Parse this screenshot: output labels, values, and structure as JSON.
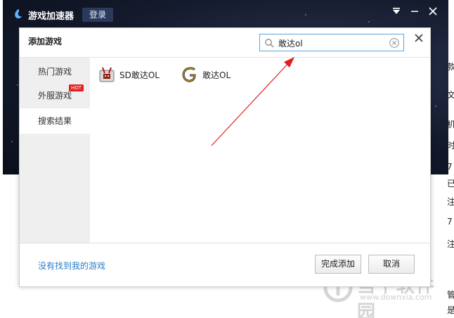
{
  "app": {
    "title": "游戏加速器",
    "login_label": "登录"
  },
  "dialog": {
    "title": "添加游戏",
    "search": {
      "value": "敢达ol",
      "placeholder": ""
    },
    "sidebar": {
      "items": [
        {
          "label": "热门游戏"
        },
        {
          "label": "外服游戏",
          "badge": "HOT"
        },
        {
          "label": "搜索结果"
        }
      ]
    },
    "results": [
      {
        "name": "SD敢达OL",
        "icon": "sd-gundam-game-icon"
      },
      {
        "name": "敢达OL",
        "icon": "gundam-g-game-icon"
      }
    ],
    "footer": {
      "not_found_link": "没有找到我的游戏",
      "done_label": "完成添加",
      "cancel_label": "取消"
    }
  },
  "background": {
    "right_chars": [
      "款",
      "文",
      "机",
      "时",
      "7",
      "已",
      "注",
      "7",
      "注",
      "管",
      "是"
    ]
  },
  "watermark": {
    "text": "当下软件园",
    "url": "www.downxia.com"
  },
  "colors": {
    "accent": "#58a6e2",
    "link": "#2a7fc9",
    "hot_badge": "#e02020",
    "arrow": "#e02020"
  }
}
